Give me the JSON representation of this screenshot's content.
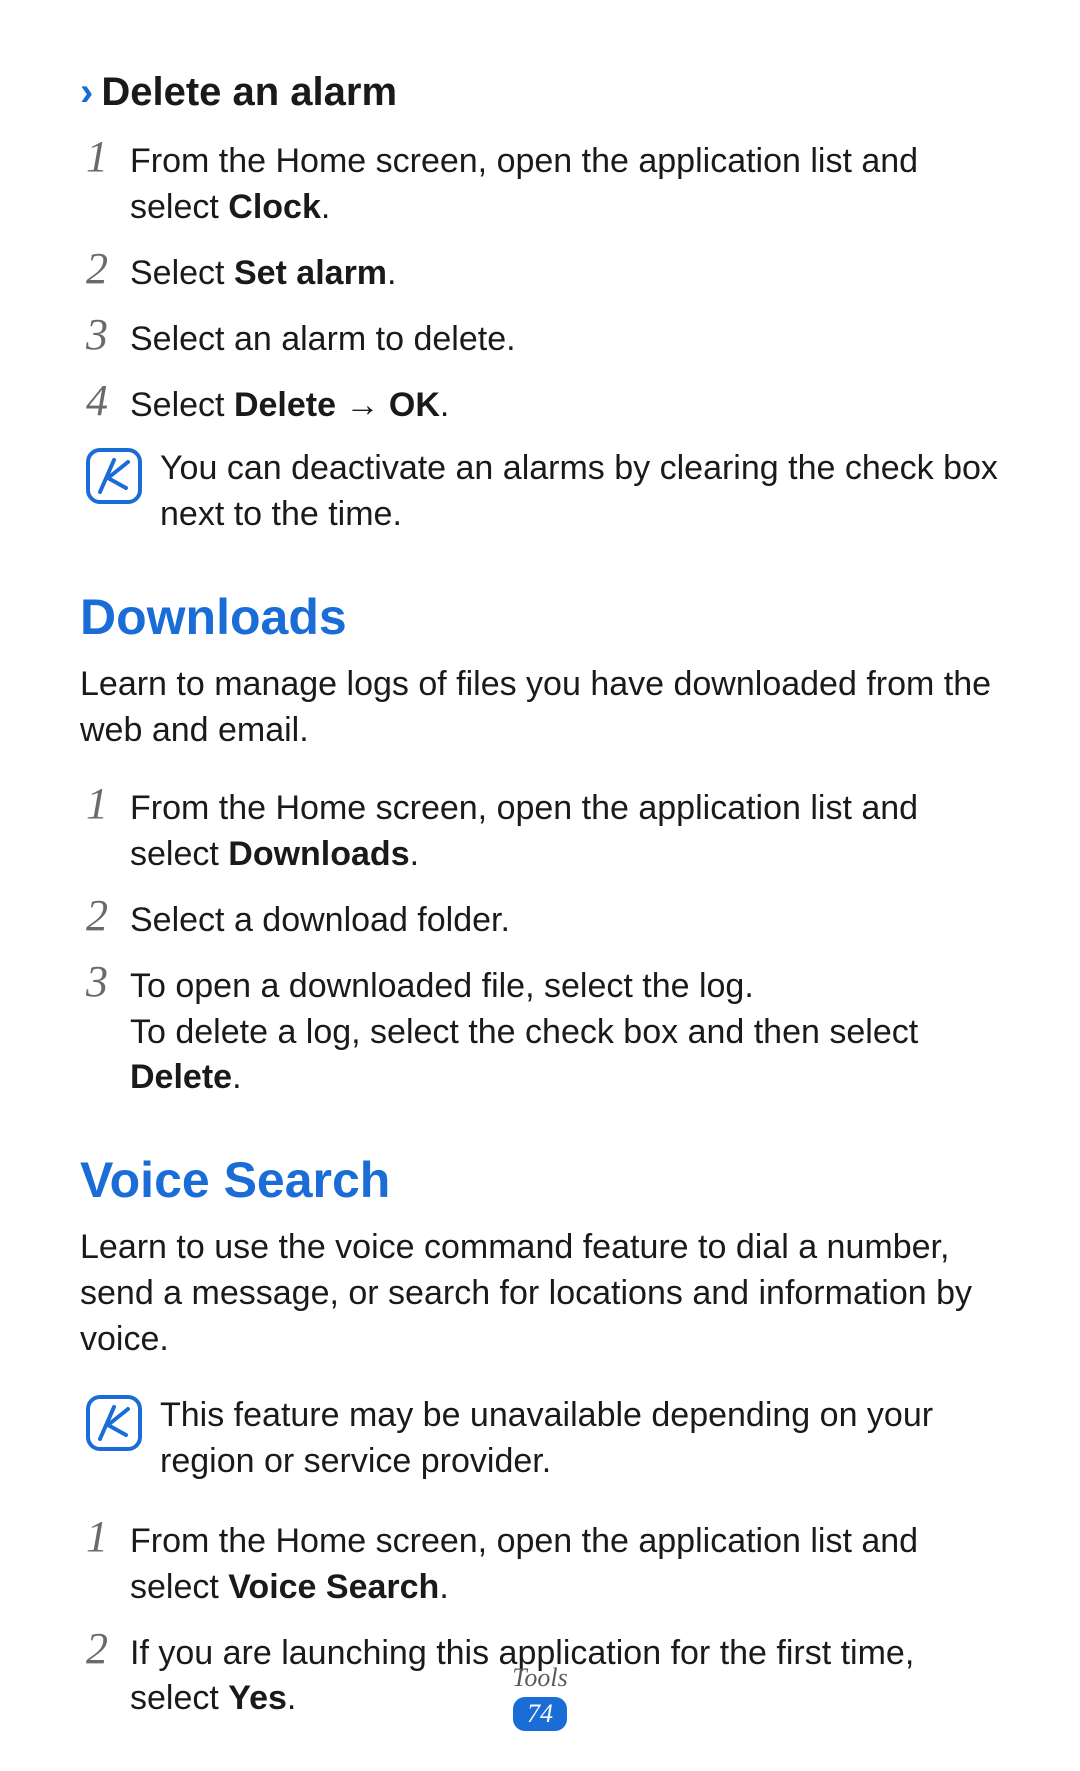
{
  "delete_alarm": {
    "chevron": "›",
    "title": "Delete an alarm",
    "step1_prefix": "From the Home screen, open the application list and select ",
    "step1_bold": "Clock",
    "step1_suffix": ".",
    "step2_prefix": "Select ",
    "step2_bold": "Set alarm",
    "step2_suffix": ".",
    "step3": "Select an alarm to delete.",
    "step4_prefix": "Select ",
    "step4_bold1": "Delete",
    "step4_arrow": " → ",
    "step4_bold2": "OK",
    "step4_suffix": ".",
    "note": "You can deactivate an alarms by clearing the check box next to the time."
  },
  "downloads": {
    "heading": "Downloads",
    "intro": "Learn to manage logs of files you have downloaded from the web and email.",
    "step1_prefix": "From the Home screen, open the application list and select ",
    "step1_bold": "Downloads",
    "step1_suffix": ".",
    "step2": "Select a download folder.",
    "step3_line1": "To open a downloaded file, select the log.",
    "step3_line2_prefix": "To delete a log, select the check box and then select ",
    "step3_line2_bold": "Delete",
    "step3_line2_suffix": "."
  },
  "voice_search": {
    "heading": "Voice Search",
    "intro": "Learn to use the voice command feature to dial a number, send a message, or search for locations and information by voice.",
    "note": "This feature may be unavailable depending on your region or service provider.",
    "step1_prefix": "From the Home screen, open the application list and select ",
    "step1_bold": "Voice Search",
    "step1_suffix": ".",
    "step2_prefix": "If you are launching this application for the first time, select ",
    "step2_bold": "Yes",
    "step2_suffix": "."
  },
  "footer": {
    "section": "Tools",
    "page": "74"
  },
  "nums": {
    "n1": "1",
    "n2": "2",
    "n3": "3",
    "n4": "4"
  }
}
